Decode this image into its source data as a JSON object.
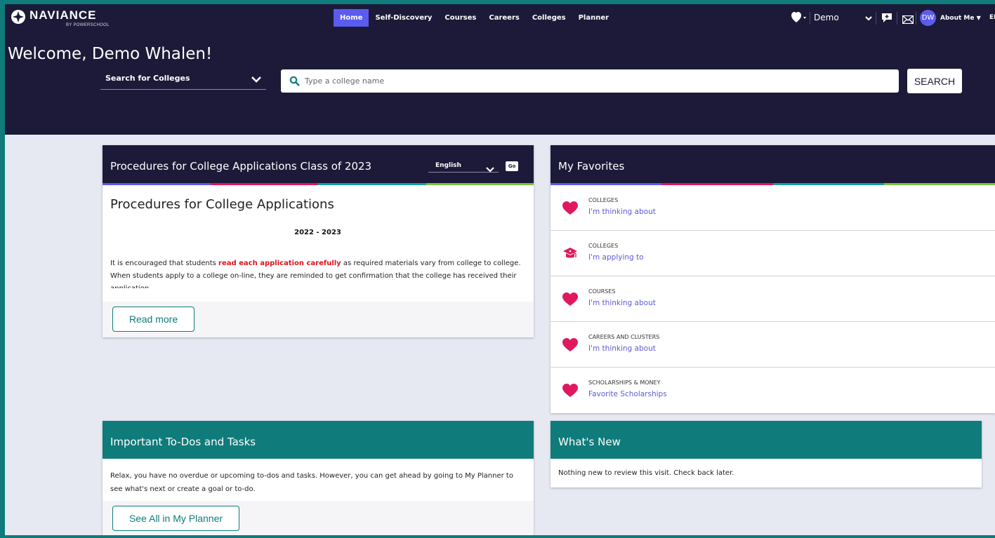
{
  "brand": {
    "name": "NAVIANCE",
    "sub": "BY POWERSCHOOL"
  },
  "nav": {
    "items": [
      {
        "label": "Home",
        "active": true
      },
      {
        "label": "Self-Discovery",
        "active": false
      },
      {
        "label": "Courses",
        "active": false
      },
      {
        "label": "Careers",
        "active": false
      },
      {
        "label": "Colleges",
        "active": false
      },
      {
        "label": "Planner",
        "active": false
      }
    ]
  },
  "utility": {
    "favorites_icon": "heart-icon",
    "profile_label": "Demo",
    "messages_icon": "chat-icon",
    "mail_icon": "mail-icon",
    "avatar_initials": "DW",
    "about_label": "About Me",
    "language_label": "EN"
  },
  "welcome": "Welcome, Demo Whalen!",
  "search": {
    "type_label": "Search for Colleges",
    "placeholder": "Type a college name",
    "button_label": "SEARCH"
  },
  "procedures": {
    "title": "Procedures for College Applications Class of 2023",
    "language": "English",
    "go_label": "Go",
    "heading": "Procedures for College Applications",
    "year": "2022 - 2023",
    "text_pre": "It is encouraged that students ",
    "text_highlight": "read each application carefully",
    "text_post": " as required materials vary from college to college.  When students apply to a college on-line, they are reminded to get confirmation that the college has received their application.",
    "read_more_label": "Read more"
  },
  "favorites": {
    "title": "My Favorites",
    "items": [
      {
        "icon": "heart-icon",
        "category": "COLLEGES",
        "label": "I'm thinking about"
      },
      {
        "icon": "graduation-cap-icon",
        "category": "COLLEGES",
        "label": "I'm applying to"
      },
      {
        "icon": "heart-icon",
        "category": "COURSES",
        "label": "I'm thinking about"
      },
      {
        "icon": "heart-icon",
        "category": "CAREERS AND CLUSTERS",
        "label": "I'm thinking about"
      },
      {
        "icon": "heart-icon",
        "category": "SCHOLARSHIPS & MONEY",
        "label": "Favorite Scholarships"
      }
    ]
  },
  "todos": {
    "title": "Important To-Dos and Tasks",
    "text": "Relax, you have no overdue or upcoming to-dos and tasks. However, you can get ahead by going to My Planner to see what's next or create a goal or to-do.",
    "button_label": "See All in My Planner"
  },
  "whats_new": {
    "title": "What's New",
    "text": "Nothing new to review this visit. Check back later."
  },
  "colors": {
    "header_bg": "#1c1a38",
    "accent_purple": "#5b5bf0",
    "accent_pink": "#e0185f",
    "teal": "#0f7b7b",
    "link": "#5b5bd6"
  }
}
